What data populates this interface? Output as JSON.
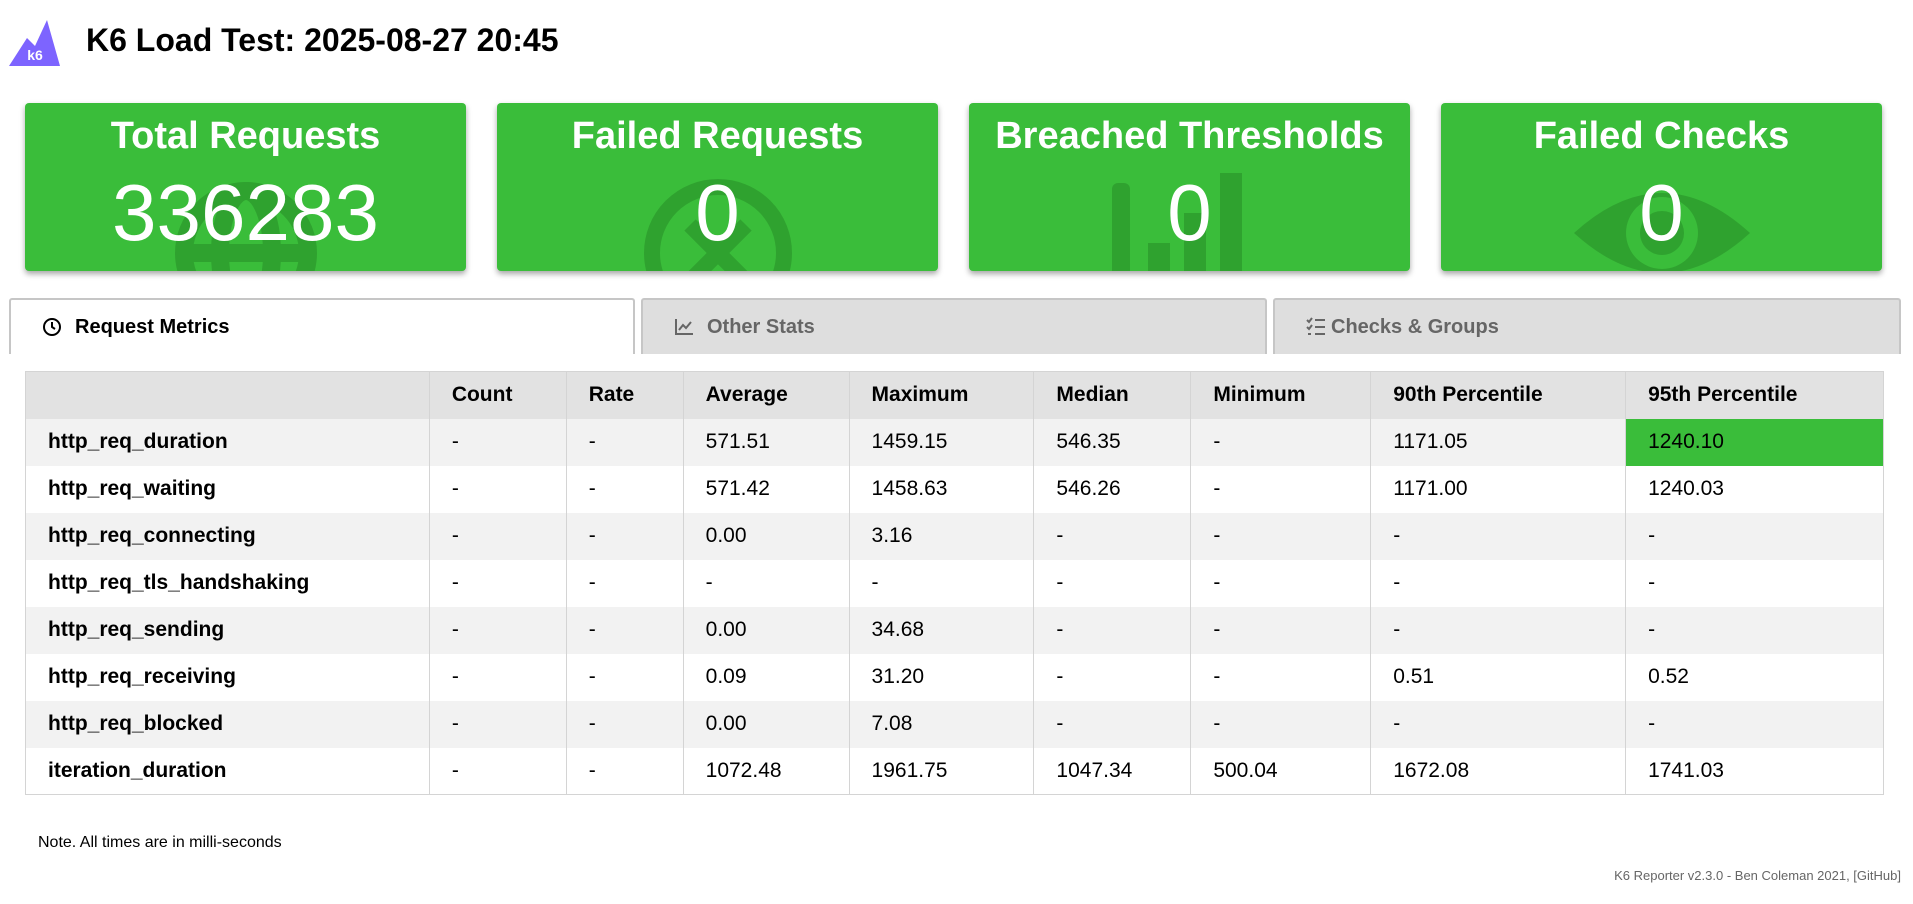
{
  "header": {
    "title": "K6 Load Test: 2025-08-27 20:45",
    "logo_text": "k6",
    "logo_color": "#7d64ff"
  },
  "summary": [
    {
      "label": "Total Requests",
      "value": "336283",
      "icon": "globe-icon"
    },
    {
      "label": "Failed Requests",
      "value": "0",
      "icon": "x-circle-icon"
    },
    {
      "label": "Breached Thresholds",
      "value": "0",
      "icon": "bar-chart-icon"
    },
    {
      "label": "Failed Checks",
      "value": "0",
      "icon": "eye-icon"
    }
  ],
  "tabs": [
    {
      "label": "Request Metrics",
      "icon": "clock-icon",
      "active": true
    },
    {
      "label": "Other Stats",
      "icon": "line-chart-icon",
      "active": false
    },
    {
      "label": "Checks & Groups",
      "icon": "checklist-icon",
      "active": false
    }
  ],
  "table": {
    "columns": [
      "",
      "Count",
      "Rate",
      "Average",
      "Maximum",
      "Median",
      "Minimum",
      "90th Percentile",
      "95th Percentile"
    ],
    "rows": [
      [
        "http_req_duration",
        "-",
        "-",
        "571.51",
        "1459.15",
        "546.35",
        "-",
        "1171.05",
        "1240.10"
      ],
      [
        "http_req_waiting",
        "-",
        "-",
        "571.42",
        "1458.63",
        "546.26",
        "-",
        "1171.00",
        "1240.03"
      ],
      [
        "http_req_connecting",
        "-",
        "-",
        "0.00",
        "3.16",
        "-",
        "-",
        "-",
        "-"
      ],
      [
        "http_req_tls_handshaking",
        "-",
        "-",
        "-",
        "-",
        "-",
        "-",
        "-",
        "-"
      ],
      [
        "http_req_sending",
        "-",
        "-",
        "0.00",
        "34.68",
        "-",
        "-",
        "-",
        "-"
      ],
      [
        "http_req_receiving",
        "-",
        "-",
        "0.09",
        "31.20",
        "-",
        "-",
        "0.51",
        "0.52"
      ],
      [
        "http_req_blocked",
        "-",
        "-",
        "0.00",
        "7.08",
        "-",
        "-",
        "-",
        "-"
      ],
      [
        "iteration_duration",
        "-",
        "-",
        "1072.48",
        "1961.75",
        "1047.34",
        "500.04",
        "1672.08",
        "1741.03"
      ]
    ]
  },
  "note": "Note. All times are in milli-seconds",
  "footer": "K6 Reporter v2.3.0 - Ben Coleman 2021, [GitHub]",
  "colors": {
    "success": "#3abd3a",
    "tab_bg": "#dedede"
  }
}
